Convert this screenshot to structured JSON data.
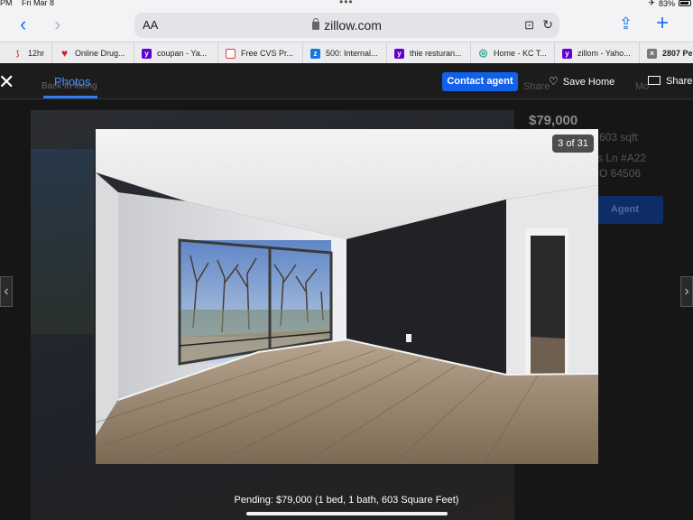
{
  "status": {
    "time": "PM",
    "date": "Fri Mar 8",
    "battery": "83%"
  },
  "browser": {
    "url": "zillow.com",
    "reader": "AA",
    "bookmarks": [
      {
        "label": "12hr",
        "icon": "pdf-icon",
        "color": "#d93025"
      },
      {
        "label": "Online Drug...",
        "icon": "heart-icon",
        "color": "#c62828"
      },
      {
        "label": "coupan - Ya...",
        "icon": "yahoo-icon",
        "color": "#6001d2"
      },
      {
        "label": "Free CVS Pr...",
        "icon": "cvs-icon",
        "color": "#e53935"
      },
      {
        "label": "500: Internal...",
        "icon": "zillow-icon",
        "color": "#1277e1"
      },
      {
        "label": "thie resturan...",
        "icon": "yahoo-icon",
        "color": "#6001d2"
      },
      {
        "label": "Home - KC T...",
        "icon": "kc-icon",
        "color": "#1b9b8a"
      },
      {
        "label": "zillom - Yaho...",
        "icon": "yahoo-icon",
        "color": "#6001d2"
      },
      {
        "label": "2807 Pe",
        "icon": "close-tab-icon",
        "color": "#777777"
      }
    ]
  },
  "header": {
    "tab_photos": "Photos",
    "contact_button": "Contact agent",
    "save_home": "Save Home",
    "share": "Share",
    "back_listing": "Back to listing",
    "accent": "#1060e8"
  },
  "background": {
    "price": "$79,000",
    "sqft": "603 sqft",
    "address_1": "s Ln #A22",
    "address_2": "O 64506",
    "contact": "Agent",
    "share": "Share",
    "more": "Mo"
  },
  "photo": {
    "counter": "3 of 31",
    "caption": "Pending: $79,000 (1 bed, 1 bath, 603 Square Feet)"
  }
}
